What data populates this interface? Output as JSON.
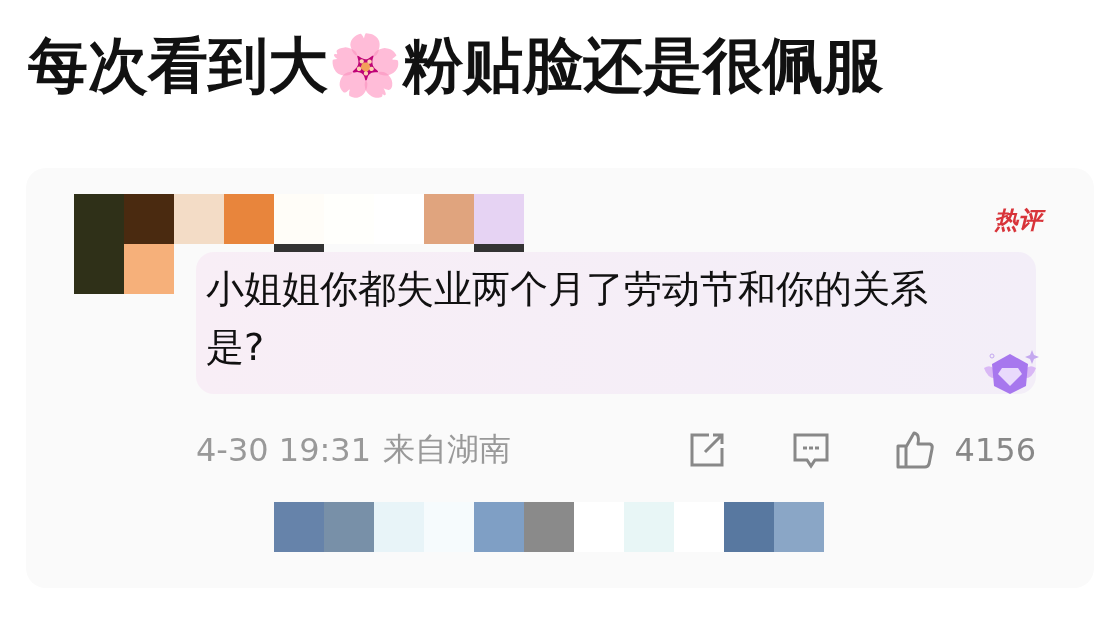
{
  "title": "每次看到大🌸粉贴脸还是很佩服",
  "comment": {
    "badge": "热评",
    "text": "小姐姐你都失业两个月了劳动节和你的关系是?",
    "time": "4-30 19:31",
    "location": "来自湖南",
    "likes": "4156"
  }
}
